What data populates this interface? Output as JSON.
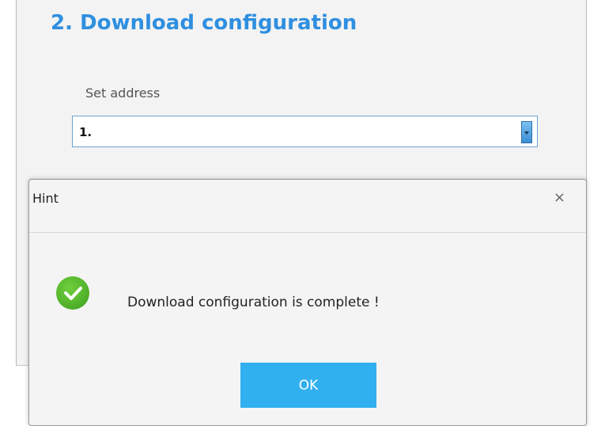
{
  "section": {
    "title": "2. Download configuration",
    "field_label": "Set address",
    "select_value": "1."
  },
  "dialog": {
    "title": "Hint",
    "close_symbol": "×",
    "message": "Download configuration is complete !",
    "ok_label": "OK",
    "icon": "check-circle-icon"
  },
  "colors": {
    "title_blue": "#2f8fe0",
    "ok_button": "#31b0f0",
    "check_green": "#4caf2a"
  }
}
